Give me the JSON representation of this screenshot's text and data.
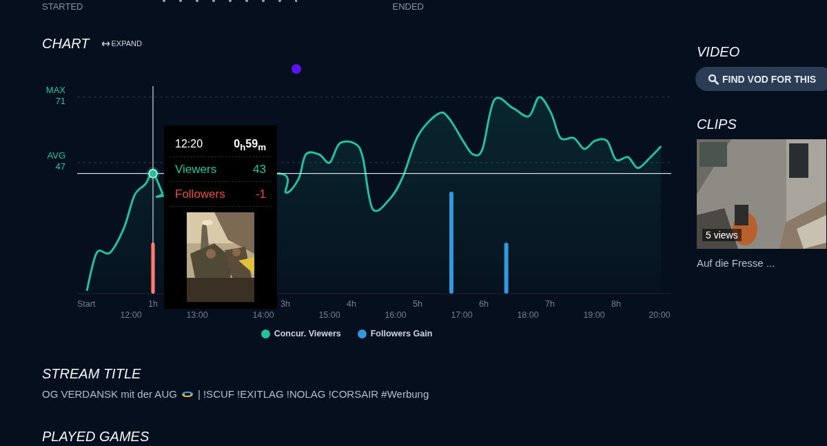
{
  "stream_times": {
    "started_label": "STARTED",
    "ended_label": "ENDED"
  },
  "chart": {
    "title": "CHART",
    "expand_button": "EXPAND",
    "reference_labels": [
      {
        "name": "MAX",
        "reading": "71"
      },
      {
        "name": "AVG",
        "reading": "47"
      }
    ],
    "hour_labels": [
      "Start",
      "1h",
      "3h",
      "4h",
      "5h",
      "6h",
      "7h",
      "8h"
    ],
    "clock_labels": [
      "12:00",
      "13:00",
      "14:00",
      "15:00",
      "16:00",
      "17:00",
      "18:00",
      "19:00",
      "20:00"
    ],
    "legend": [
      {
        "label": "Concur. Viewers",
        "color": "#22c39b"
      },
      {
        "label": "Followers Gain",
        "color": "#3498db"
      }
    ],
    "tooltip": {
      "time": "12:20",
      "duration": "0$_{h}$59$_{m}$",
      "rows": [
        {
          "kind": "viewers",
          "label": "Viewers",
          "value": "43"
        },
        {
          "kind": "followers",
          "label": "Followers",
          "value": "-1"
        }
      ]
    }
  },
  "video": {
    "title": "VIDEO",
    "find_vod_button": "FIND VOD FOR THIS"
  },
  "clips": {
    "title": "CLIPS",
    "items": [
      {
        "views": "5 views",
        "title": "Auf die Fresse ..."
      }
    ]
  },
  "stream_title": {
    "heading": "STREAM TITLE",
    "text_before_emoji": "OG VERDANSK mit der AUG",
    "text_after_emoji": "| !SCUF !EXITLAG !NOLAG !CORSAIR #Werbung"
  },
  "played_games": {
    "heading": "PLAYED GAMES"
  }
}
